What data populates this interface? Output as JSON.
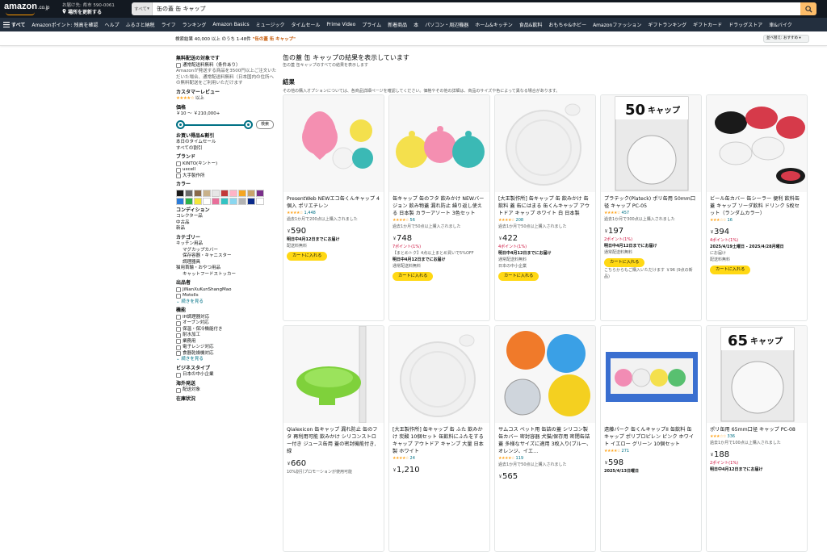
{
  "header": {
    "logo": "amazon",
    "logo_region": ".co.jp",
    "deliver_line1": "お届け先: 県市 590-0061",
    "deliver_line2": "場所を更新する",
    "search_category": "すべて",
    "search_value": "缶の蓋 缶 キャップ"
  },
  "subnav": {
    "all_label": "すべて",
    "items": [
      "Amazonポイント: 残高を確認",
      "ヘルプ",
      "ふるさと納税",
      "ライフ",
      "ランキング",
      "Amazon Basics",
      "ミュージック",
      "タイムセール",
      "Prime Video",
      "プライム",
      "新着商品",
      "本",
      "パソコン・周辺機器",
      "ホーム&キッチン",
      "食品&飲料",
      "おもちゃ&ホビー",
      "Amazonファッション",
      "ギフトランキング",
      "ギフトカード",
      "ドラッグストア",
      "車&バイク"
    ]
  },
  "resultsbar": {
    "prefix": "検索結果 40,000 以上 のうち 1-48件 ",
    "query": "\"缶の蓋 缶 キャップ\"",
    "sort": "並べ替え: おすすめ"
  },
  "sidebar": {
    "free_ship_title": "無料配送の対象です",
    "free_ship_option": "通常配送料無料（条件あり）",
    "free_ship_note": "Amazonが発送する商品を3500円以上ご注文いただいた場合、通常配送料無料（日本国内の住所への無料配送をご利用いただけます",
    "review_title": "カスタマーレビュー",
    "review_stars": "★★★★☆",
    "review_suffix": "以上",
    "price_title": "価格",
    "price_range": "￥10 〜 ￥210,000+",
    "price_go": "検索",
    "deals_title": "お買い得品&割引",
    "deals": [
      "本日のタイムセール",
      "すべての割引"
    ],
    "brand_title": "ブランド",
    "brands": [
      "KINTO(キントー)",
      "uxcell",
      "大手製作所"
    ],
    "color_title": "カラー",
    "colors": [
      "#1a1a1a",
      "#6b6b6b",
      "#8a6a4a",
      "#c9b28a",
      "#e6e6e6",
      "#c23a3a",
      "#ffb3c6",
      "#f5a623",
      "#c8a46a",
      "#7a2f8a",
      "#2a7bd8",
      "#2db34a",
      "#f3e53a",
      "#ffffff",
      "#e86f9a",
      "#33c3c3",
      "#8ad7f0",
      "#b3b3b3",
      "#0a2a8a",
      "#ffffff"
    ],
    "condition_title": "コンディション",
    "conditions": [
      "コレクター品",
      "中古品",
      "新品"
    ],
    "category_title": "カテゴリー",
    "categories": [
      "キッチン用品",
      "マグカップカバー",
      "保存容器・キャニスター",
      "調理器具",
      "猫用首輪・おやつ用品",
      "キャットフードストッカー"
    ],
    "maker_title": "出品者",
    "makers": [
      "JiNanXuKunShangMao",
      "Motolls"
    ],
    "more": "続きを見る",
    "features_title": "機能",
    "features": [
      "IH調理器対応",
      "オーブン対応",
      "保温・保冷機能付き",
      "耐水加工",
      "業務用",
      "電子レンジ対応",
      "食器乾燥機対応"
    ],
    "business_title": "ビジネスタイプ",
    "business": [
      "日本の中小企業"
    ],
    "overseas_title": "海外発送",
    "overseas": [
      "配送対象"
    ],
    "stock_title": "在庫状況"
  },
  "main": {
    "heading": "缶の蓋 缶 キャップの結果を表示しています",
    "subheading": "缶の蓋 缶キャップのすべての結果を表示します",
    "results": "結果",
    "results_note": "その他の購入オプションについては、各商品詳細ページを確認してください。価格やその他の詳細は、商品のサイズや色によって異なる場合があります。"
  },
  "products": [
    {
      "title": "PresentWeb NEWエコ缶くんキャップ 4個入 ポリエチレン",
      "stars": "★★★★☆",
      "reviews": "1,448",
      "sold": "過去1か月で200点以上購入されました",
      "price": "590",
      "points": "",
      "delivery": "明日中4月12日までにお届け",
      "ship": "配送料無料",
      "extra": "",
      "button": "カートに入れる"
    },
    {
      "title": "缶キャップ 缶のフタ 飲みかけ NEWバージョン 飲み物蓋 漏れ防止 繰り返し使える 日本製 カラーアソート 3色セット",
      "stars": "★★★★☆",
      "reviews": "56",
      "sold": "過去1か月で50点以上購入されました",
      "price": "748",
      "points": "7ポイント(1%)",
      "delivery": "明日中4月12日までにお届け",
      "ship": "通常配送料無料",
      "extra": "【まとめトク】4点以上まとめ買いで5%OFF",
      "button": "カートに入れる"
    },
    {
      "title": "[大王製作所] 缶キャップ 缶 飲みかけ 缶飲料 蓋 缶にはまる 缶くんキャップ アウトドア キャップ ホワイト 白 日本製",
      "stars": "★★★★☆",
      "reviews": "208",
      "sold": "過去1か月で50点以上購入されました",
      "price": "422",
      "points": "4ポイント(1%)",
      "delivery": "明日中4月12日までにお届け",
      "ship": "通常配送料無料",
      "extra": "日本の中小企業",
      "button": "カートに入れる"
    },
    {
      "title": "プラテック(Plateck) ポリ缶用 50mm口径 キャップ PC-05",
      "stars": "★★★★☆",
      "reviews": "457",
      "sold": "過去1か月で300点以上購入されました",
      "price": "197",
      "points": "2ポイント(1%)",
      "delivery": "明日中4月12日までにお届け",
      "ship": "通常配送料無料",
      "extra": "こちらからもご購入いただけます ￥96 (9点の新品)",
      "button": "カートに入れる"
    },
    {
      "title": "ビール缶カバー 缶シーラー 便利 飲料缶 蓋 キャップ ソーダ飲料 ドリンク 5枚セット（ランダムカラー）",
      "stars": "★★★☆☆",
      "reviews": "16",
      "sold": "",
      "price": "394",
      "points": "4ポイント(1%)",
      "delivery": "2025/4/19土曜日 - 2025/4/28月曜日",
      "ship": "にお届け",
      "extra": "配送料無料",
      "button": "カートに入れる"
    },
    {
      "title": "Qialexicon 缶キャップ 漏れ防止 缶のフタ 再利用可能 飲みかけ シリコンストロー付き ジュース缶用 蓋の密封機能付き, 緑",
      "stars": "",
      "reviews": "",
      "sold": "",
      "price": "660",
      "points": "10%割引プロモーションが使用可能",
      "delivery": "",
      "ship": "",
      "extra": "",
      "button": ""
    },
    {
      "title": "[大王製作所] 缶キャップ 缶 ふた 飲みかけ 炭酸 10個セット 缶飲料にふたをするキャップ アウトドア キャンプ 大量 日本製 ホワイト",
      "stars": "★★★★☆",
      "reviews": "24",
      "sold": "",
      "price": "1,210",
      "points": "",
      "delivery": "",
      "ship": "",
      "extra": "",
      "button": ""
    },
    {
      "title": "サムコス ペット用 缶詰の蓋 シリコン製 缶カバー 密封容器 犬猫/保存用 密閉缶詰蓋 多様なサイズに適用 3枚入り(ブルー、オレンジ、イエ…",
      "stars": "★★★★☆",
      "reviews": "119",
      "sold": "過去1か月で50点以上購入されました",
      "price": "565",
      "points": "",
      "delivery": "",
      "ship": "",
      "extra": "",
      "button": ""
    },
    {
      "title": "遠藤パーク 缶くんキャップII 缶飲料 缶 キャップ ポリプロピレン ピンク ホワイト イエロー グリーン 10個セット",
      "stars": "★★★★☆",
      "reviews": "271",
      "sold": "",
      "price": "598",
      "points": "",
      "delivery": "2025/4/13日曜日",
      "ship": "",
      "extra": "",
      "button": ""
    },
    {
      "title": "ポリ缶用 65mm口径 キャップ PC-08",
      "stars": "★★★☆☆",
      "reviews": "336",
      "sold": "過去1か月で100点以上購入されました",
      "price": "188",
      "points": "2ポイント(1%)",
      "delivery": "明日中4月12日までにお届け",
      "ship": "",
      "extra": "",
      "button": ""
    }
  ]
}
